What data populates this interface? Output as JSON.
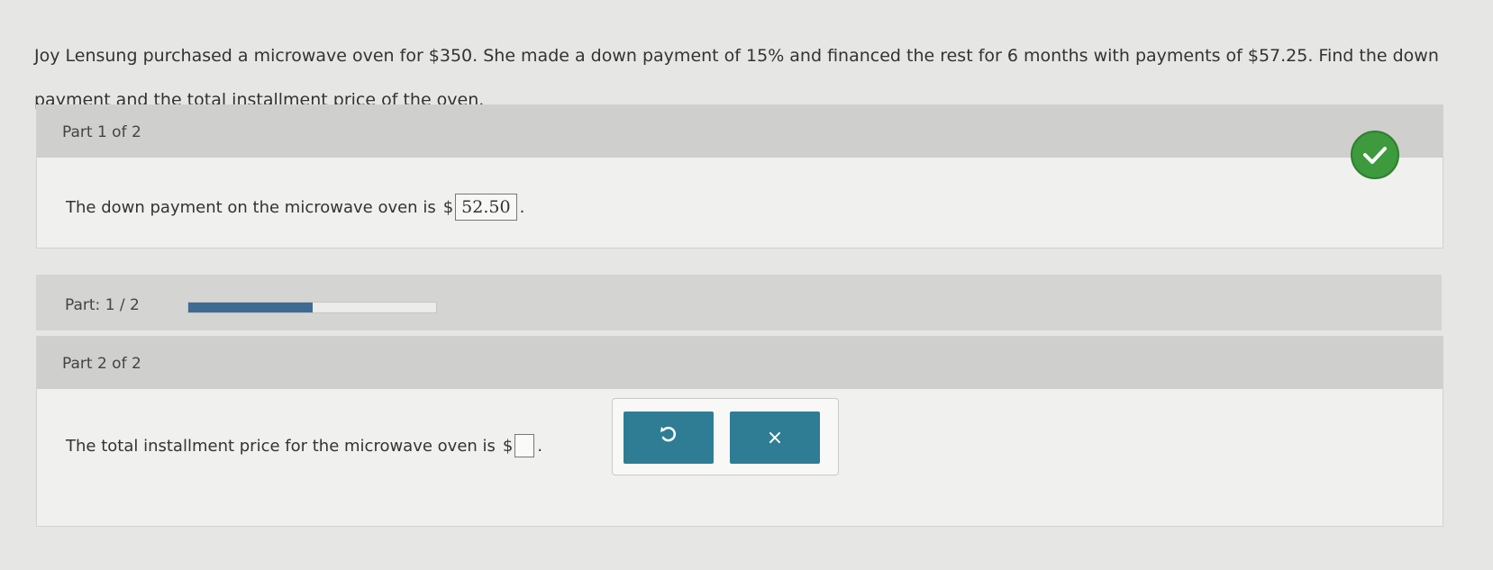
{
  "question": {
    "text": "Joy Lensung purchased a microwave oven for $350. She made a down payment of 15% and financed the rest for 6 months with payments of $57.25. Find the down payment and the total installment price of the oven."
  },
  "part1": {
    "title": "Part 1 of 2",
    "prompt": "The down payment on the microwave oven is",
    "currency": "$",
    "answer": "52.50",
    "period": ".",
    "status_icon": "check-icon"
  },
  "progress": {
    "label": "Part: 1 / 2",
    "fraction": 0.5
  },
  "part2": {
    "title": "Part 2 of 2",
    "prompt": "The total installment price for the microwave oven is",
    "currency": "$",
    "answer": "",
    "period": "."
  },
  "tools": {
    "undo_icon": "undo-icon",
    "clear_label": "×"
  },
  "colors": {
    "check_green": "#3d9a3d",
    "button_teal": "#2f7d94",
    "progress_fill": "#3f6b93"
  }
}
